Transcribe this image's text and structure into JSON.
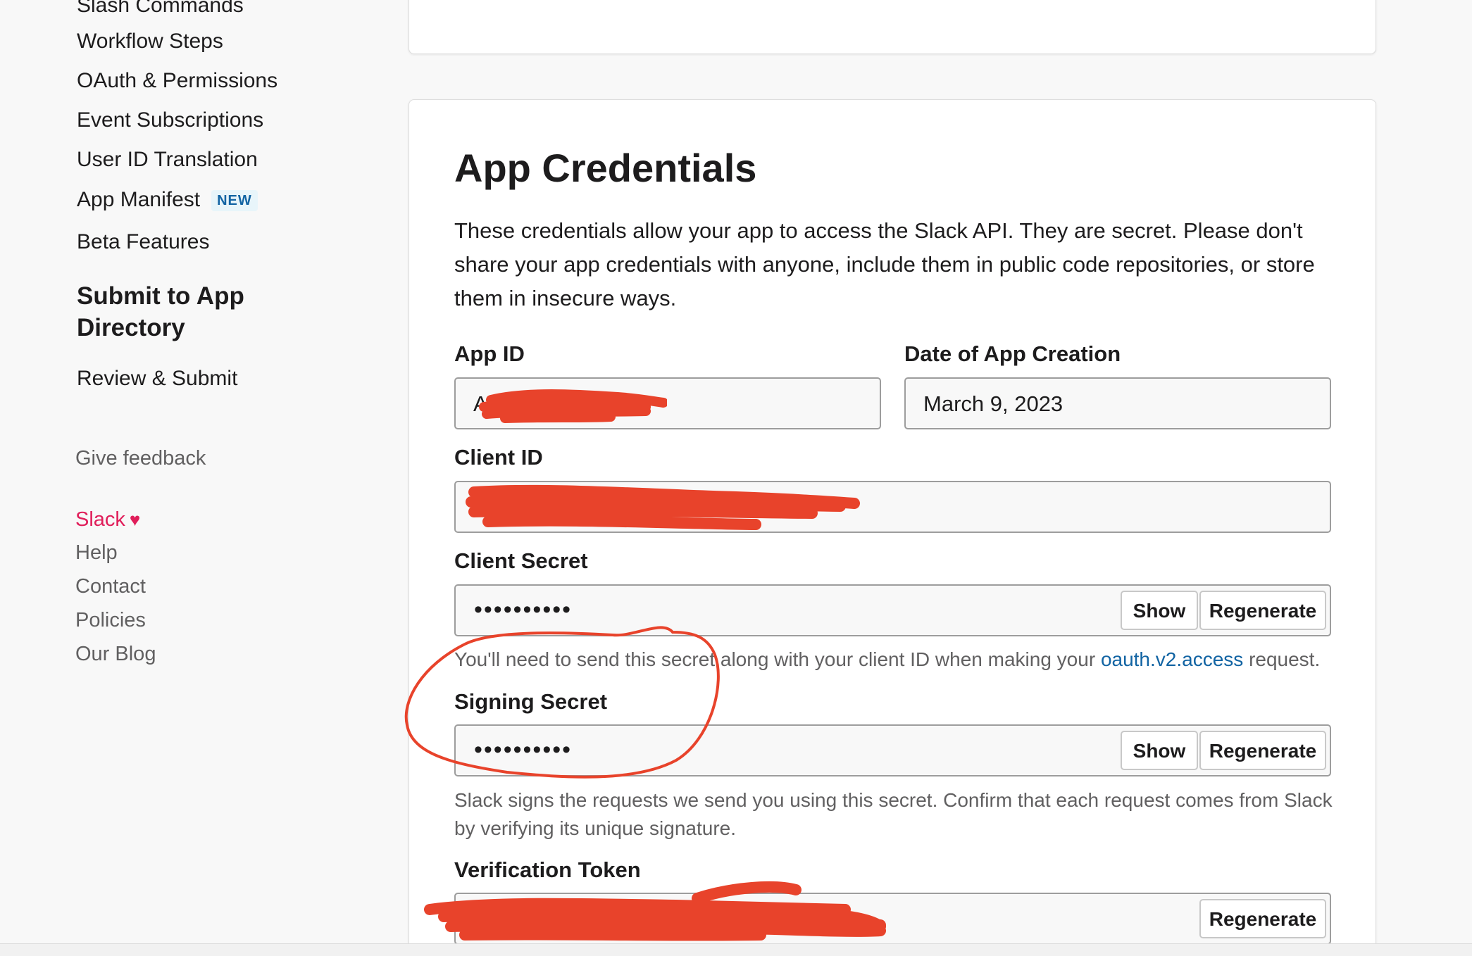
{
  "sidebar": {
    "items": [
      {
        "label": "Slash Commands"
      },
      {
        "label": "Workflow Steps"
      },
      {
        "label": "OAuth & Permissions"
      },
      {
        "label": "Event Subscriptions"
      },
      {
        "label": "User ID Translation"
      },
      {
        "label": "App Manifest",
        "badge": "NEW"
      },
      {
        "label": "Beta Features"
      }
    ],
    "section_title": "Submit to App Directory",
    "section_items": [
      {
        "label": "Review & Submit"
      }
    ],
    "feedback": "Give feedback",
    "footer": {
      "slack": "Slack",
      "links": [
        "Help",
        "Contact",
        "Policies",
        "Our Blog"
      ]
    }
  },
  "credentials": {
    "title": "App Credentials",
    "description": "These credentials allow your app to access the Slack API. They are secret. Please don't share your app credentials with anyone, include them in public code repositories, or store them in insecure ways.",
    "app_id": {
      "label": "App ID",
      "value": "A0"
    },
    "creation_date": {
      "label": "Date of App Creation",
      "value": "March 9, 2023"
    },
    "client_id": {
      "label": "Client ID",
      "value": ""
    },
    "client_secret": {
      "label": "Client Secret",
      "masked": "••••••••••",
      "show": "Show",
      "regenerate": "Regenerate",
      "help_before": "You'll need to send this secret along with your client ID when making your",
      "help_link": "oauth.v2.access",
      "help_after": "request."
    },
    "signing_secret": {
      "label": "Signing Secret",
      "masked": "••••••••••",
      "show": "Show",
      "regenerate": "Regenerate",
      "help": "Slack signs the requests we send you using this secret. Confirm that each request comes from Slack by verifying its unique signature."
    },
    "verification_token": {
      "label": "Verification Token",
      "regenerate": "Regenerate"
    }
  },
  "colors": {
    "accent_link": "#1264a3",
    "slack_pink": "#e01e5a",
    "annotation_red": "#e8432b"
  }
}
